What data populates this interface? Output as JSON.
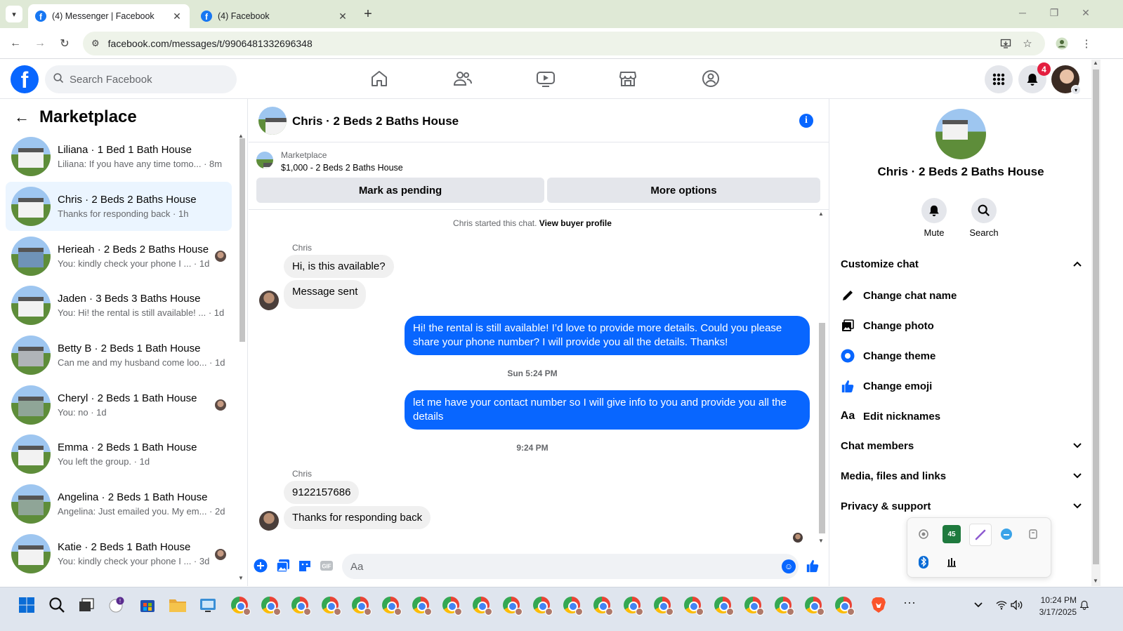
{
  "browser": {
    "tabs": [
      {
        "title": "(4) Messenger | Facebook",
        "active": true
      },
      {
        "title": "(4) Facebook",
        "active": false
      }
    ],
    "url": "facebook.com/messages/t/9906481332696348"
  },
  "header": {
    "search_placeholder": "Search Facebook",
    "notifications_count": "4"
  },
  "sidebar": {
    "title": "Marketplace",
    "conversations": [
      {
        "name": "Liliana · 1 Bed 1 Bath House",
        "snippet": "Liliana: If you have any time tomo... · 8m",
        "selected": false,
        "seen": false,
        "thumb": "white"
      },
      {
        "name": "Chris · 2 Beds 2 Baths House",
        "snippet": "Thanks for responding back · 1h",
        "selected": true,
        "seen": false,
        "thumb": "white"
      },
      {
        "name": "Herieah · 2 Beds 2 Baths House",
        "snippet": "You: kindly check your phone I ... · 1d",
        "selected": false,
        "seen": true,
        "thumb": "blue"
      },
      {
        "name": "Jaden · 3 Beds 3 Baths House",
        "snippet": "You: Hi! the rental is still available! ... · 1d",
        "selected": false,
        "seen": false,
        "thumb": "white"
      },
      {
        "name": "Betty B · 2 Beds 1 Bath House",
        "snippet": "Can me and my husband come loo... · 1d",
        "selected": false,
        "seen": false,
        "thumb": "gray"
      },
      {
        "name": "Cheryl · 2 Beds 1 Bath House",
        "snippet": "You: no · 1d",
        "selected": false,
        "seen": true,
        "thumb": "sage"
      },
      {
        "name": "Emma · 2 Beds 1 Bath House",
        "snippet": "You left the group. · 1d",
        "selected": false,
        "seen": false,
        "thumb": "white"
      },
      {
        "name": "Angelina · 2 Beds 1 Bath House",
        "snippet": "Angelina: Just emailed you. My em... · 2d",
        "selected": false,
        "seen": false,
        "thumb": "sage"
      },
      {
        "name": "Katie · 2 Beds 1 Bath House",
        "snippet": "You: kindly check your phone I ... · 3d",
        "selected": false,
        "seen": true,
        "thumb": "white"
      }
    ]
  },
  "chat": {
    "title": "Chris · 2 Beds 2 Baths House",
    "listing": {
      "category": "Marketplace",
      "price_title": "$1,000 - 2 Beds 2 Baths House",
      "pending_label": "Mark as pending",
      "options_label": "More options"
    },
    "started_text": "Chris started this chat.",
    "view_profile": "View buyer profile",
    "sender": "Chris",
    "msg_in_1": "Hi, is this available?",
    "msg_in_2": "Message sent",
    "msg_out_1": "Hi! the rental is still available! I’d love to provide more details. Could you please share your phone number? I will provide you all the details. Thanks!",
    "time_1": "Sun 5:24 PM",
    "msg_out_2": "let me have your contact number so I will give info to you and provide you all the details",
    "time_2": "9:24 PM",
    "msg_in_3": "9122157686",
    "msg_in_4": "Thanks for responding back",
    "composer_placeholder": "Aa"
  },
  "details": {
    "title": "Chris · 2 Beds 2 Baths House",
    "mute": "Mute",
    "search": "Search",
    "customize": "Customize chat",
    "change_name": "Change chat name",
    "change_photo": "Change photo",
    "change_theme": "Change theme",
    "change_emoji": "Change emoji",
    "edit_nicknames": "Edit nicknames",
    "members": "Chat members",
    "media": "Media, files and links",
    "privacy": "Privacy & support"
  },
  "taskbar": {
    "time": "10:24 PM",
    "date": "3/17/2025",
    "excel_label": "45"
  },
  "colors": {
    "fb_blue": "#0866ff",
    "selected_bg": "#ebf5ff",
    "badge_red": "#e41e3f"
  }
}
